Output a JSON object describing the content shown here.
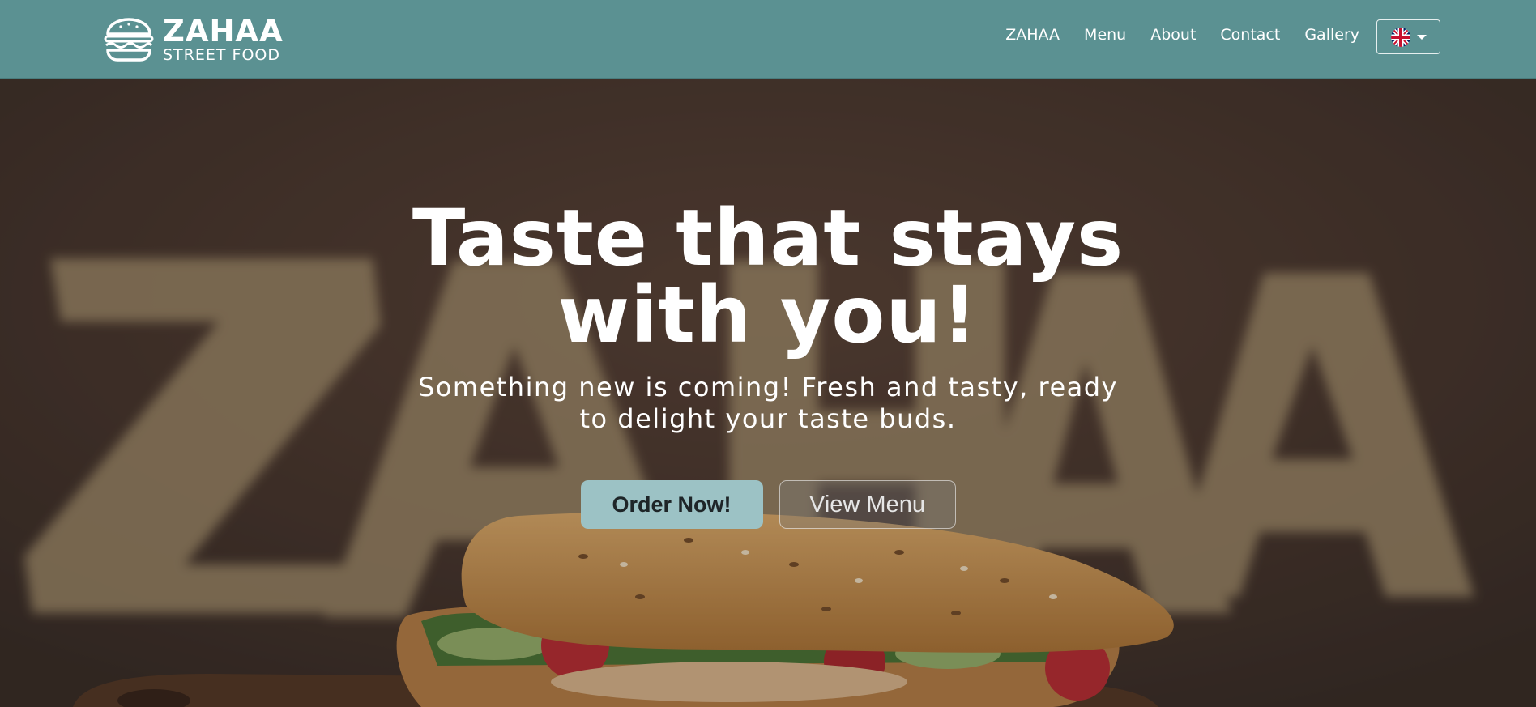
{
  "brand": {
    "name": "ZAHAA",
    "subtitle": "STREET FOOD",
    "icon": "burger-icon"
  },
  "nav": {
    "links": [
      "ZAHAA",
      "Menu",
      "About",
      "Contact",
      "Gallery"
    ],
    "language_icon": "uk-flag-icon"
  },
  "hero": {
    "title_line1": "Taste that stays",
    "title_line2": "with you!",
    "subtitle_line1": "Something new is coming! Fresh and tasty, ready",
    "subtitle_line2": "to delight your taste buds.",
    "order_button": "Order Now!",
    "menu_button": "View Menu",
    "background_image": "sandwich-in-front-of-zahaa-sign"
  },
  "colors": {
    "navbar": "#5b9192",
    "order_button": "#9cc2c5"
  }
}
